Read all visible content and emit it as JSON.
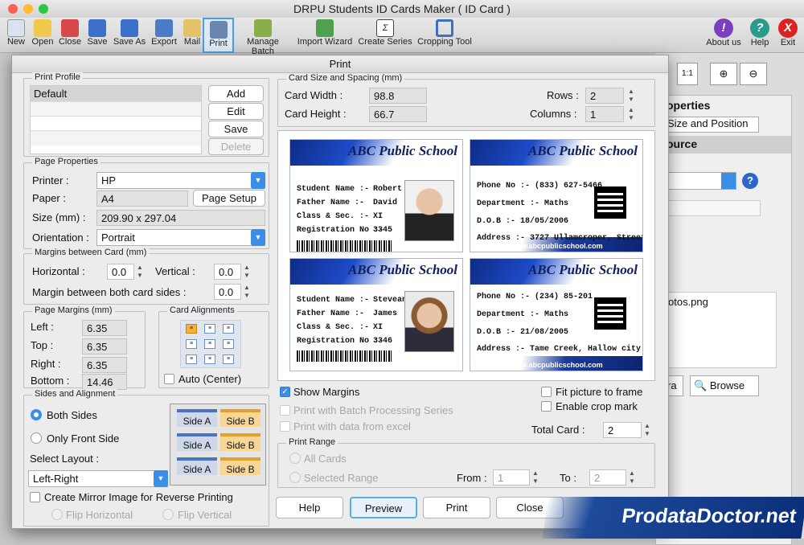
{
  "app": {
    "title": "DRPU Students ID Cards Maker ( ID Card )"
  },
  "toolbar": {
    "items": [
      {
        "label": "New",
        "color": "#d9e2f0"
      },
      {
        "label": "Open",
        "color": "#f1c94c"
      },
      {
        "label": "Close",
        "color": "#d84848"
      },
      {
        "label": "Save",
        "color": "#3c6fc7"
      },
      {
        "label": "Save As",
        "color": "#3c6fc7"
      },
      {
        "label": "Export",
        "color": "#4a7cc7"
      },
      {
        "label": "Mail",
        "color": "#e3c36a"
      },
      {
        "label": "Print",
        "color": "#6a86b0"
      },
      {
        "label": "Manage Batch",
        "color": "#8cae4a"
      },
      {
        "label": "Import Wizard",
        "color": "#4fa04f"
      },
      {
        "label": "Create Series",
        "color": "#444"
      },
      {
        "label": "Cropping Tool",
        "color": "#4070c0"
      }
    ],
    "right": [
      {
        "label": "About us",
        "glyph": "!",
        "color": "#7b3fbf"
      },
      {
        "label": "Help",
        "glyph": "?",
        "color": "#2a9a8a"
      },
      {
        "label": "Exit",
        "glyph": "X",
        "color": "#d22"
      }
    ]
  },
  "background": {
    "properties": "operties",
    "size_position": "Size and Position",
    "source": "ource",
    "file": "otos.png",
    "browse_prefix": "ra",
    "browse": "Browse"
  },
  "dialog": {
    "title": "Print",
    "print_profile": {
      "legend": "Print Profile",
      "items": [
        "Default"
      ],
      "add": "Add",
      "edit": "Edit",
      "save": "Save",
      "delete": "Delete"
    },
    "page_properties": {
      "legend": "Page Properties",
      "printer_label": "Printer :",
      "printer": "HP",
      "paper_label": "Paper :",
      "paper": "A4",
      "page_setup": "Page Setup",
      "size_label": "Size (mm) :",
      "size": "209.90 x 297.04",
      "orientation_label": "Orientation :",
      "orientation": "Portrait"
    },
    "margins_between": {
      "legend": "Margins between Card (mm)",
      "horizontal_label": "Horizontal :",
      "horizontal": "0.0",
      "vertical_label": "Vertical :",
      "vertical": "0.0",
      "both_label": "Margin between both card sides :",
      "both": "0.0"
    },
    "page_margins": {
      "legend": "Page Margins (mm)",
      "left_label": "Left :",
      "left": "6.35",
      "top_label": "Top :",
      "top": "6.35",
      "right_label": "Right :",
      "right": "6.35",
      "bottom_label": "Bottom :",
      "bottom": "14.46"
    },
    "card_alignments": {
      "legend": "Card Alignments",
      "auto": "Auto (Center)"
    },
    "sides": {
      "legend": "Sides and Alignment",
      "both": "Both Sides",
      "front": "Only Front Side",
      "layout_label": "Select Layout :",
      "layout": "Left-Right",
      "side_a": "Side A",
      "side_b": "Side B",
      "mirror": "Create Mirror Image for Reverse Printing",
      "flip_h": "Flip Horizontal",
      "flip_v": "Flip Vertical"
    },
    "card_size": {
      "legend": "Card Size and Spacing (mm)",
      "width_label": "Card Width :",
      "width": "98.8",
      "height_label": "Card Height :",
      "height": "66.7",
      "rows_label": "Rows :",
      "rows": "2",
      "cols_label": "Columns :",
      "cols": "1"
    },
    "cards": [
      {
        "school": "ABC Public School",
        "r1k": "Student Name :-",
        "r1v": "Robert",
        "r2k": "Father Name :-",
        "r2v": "David",
        "r3k": "Class & Sec. :-",
        "r3v": "XI",
        "r4k": "Registration No :-",
        "r4v": "3345"
      },
      {
        "school": "ABC Public School",
        "r1k": "Phone No :-",
        "r1v": "(833) 627-5466",
        "r2k": "Department :-",
        "r2v": "Maths",
        "r3k": "D.O.B :-",
        "r3v": "18/05/2006",
        "r4k": "Address :-",
        "r4v": "3727 Ullamcroper, Street.",
        "url": "www.abcpublicschool.com"
      },
      {
        "school": "ABC Public School",
        "r1k": "Student Name :-",
        "r1v": "Stevean",
        "r2k": "Father Name :-",
        "r2v": "James",
        "r3k": "Class & Sec. :-",
        "r3v": "XI",
        "r4k": "Registration No :-",
        "r4v": "3346"
      },
      {
        "school": "ABC Public School",
        "r1k": "Phone No :-",
        "r1v": "(234) 85-201",
        "r2k": "Department :-",
        "r2v": "Maths",
        "r3k": "D.O.B :-",
        "r3v": "21/08/2005",
        "r4k": "Address :-",
        "r4v": "Tame Creek, Hallow city",
        "url": "www.abcpublicschool.com"
      }
    ],
    "options": {
      "show_margins": "Show Margins",
      "batch": "Print with Batch Processing Series",
      "excel": "Print with data from excel",
      "fit": "Fit picture to frame",
      "crop": "Enable crop mark",
      "total_label": "Total Card :",
      "total": "2"
    },
    "range": {
      "legend": "Print Range",
      "all": "All Cards",
      "selected": "Selected Range",
      "from_label": "From :",
      "from": "1",
      "to_label": "To :",
      "to": "2"
    },
    "buttons": {
      "help": "Help",
      "preview": "Preview",
      "print": "Print",
      "close": "Close"
    }
  },
  "watermark": "ProdataDoctor.net"
}
